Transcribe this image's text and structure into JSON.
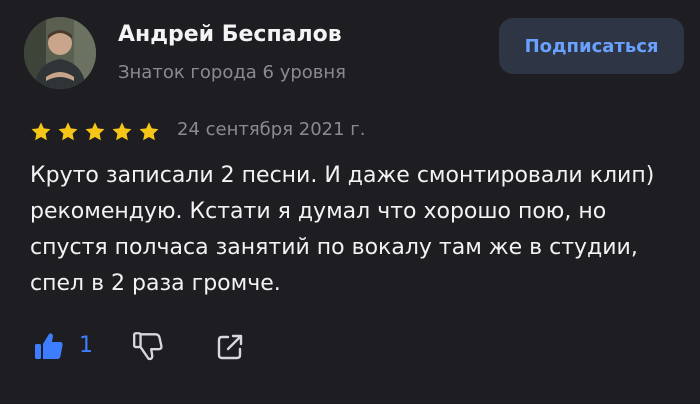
{
  "review": {
    "author": {
      "name": "Андрей Беспалов",
      "level": "Знаток города 6 уровня",
      "avatar_icon": "user-photo"
    },
    "subscribe_label": "Подписаться",
    "rating": {
      "stars": 5,
      "max": 5
    },
    "date": "24 сентября 2021 г.",
    "text": "Круто записали 2 песни. И даже смонтировали клип) рекомендую. Кстати я думал что хорошо пою, но спустя полчаса занятий по вокалу там же в студии, спел в 2 раза громче.",
    "actions": {
      "likes": "1",
      "like_icon": "thumbs-up-icon",
      "dislike_icon": "thumbs-down-icon",
      "share_icon": "share-icon"
    }
  },
  "colors": {
    "background": "#1e1e22",
    "accent": "#3d7dff",
    "star": "#f5c518",
    "muted_text": "#8a8a90",
    "button_bg": "#2e3646"
  }
}
